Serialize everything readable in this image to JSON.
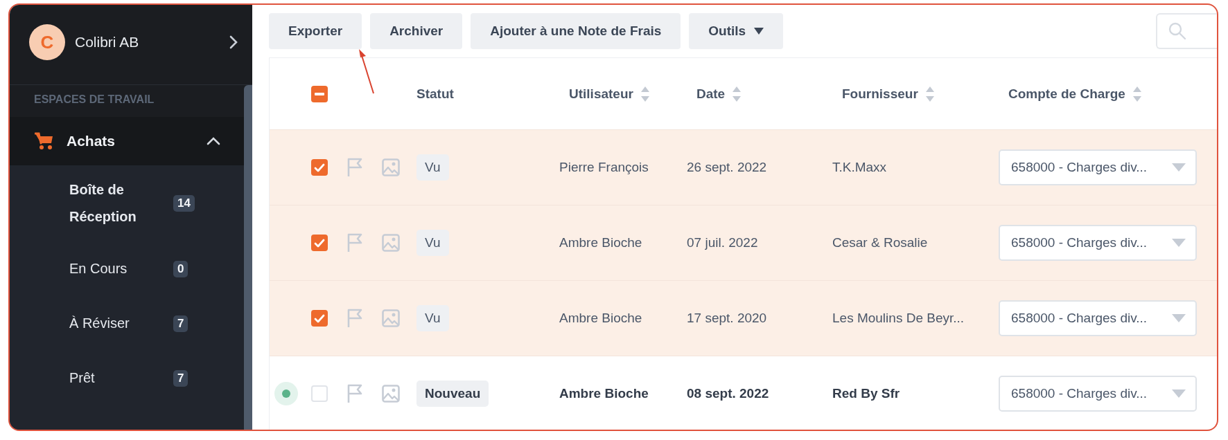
{
  "account": {
    "initial": "C",
    "name": "Colibri AB"
  },
  "sidebar": {
    "section_label": "ESPACES DE TRAVAIL",
    "group": {
      "label": "Achats",
      "expanded": true,
      "items": [
        {
          "label": "Boîte de Réception",
          "count": "14",
          "selected": true
        },
        {
          "label": "En Cours",
          "count": "0",
          "selected": false
        },
        {
          "label": "À Réviser",
          "count": "7",
          "selected": false
        },
        {
          "label": "Prêt",
          "count": "7",
          "selected": false
        }
      ]
    }
  },
  "toolbar": {
    "buttons": [
      {
        "label": "Exporter",
        "kind": "button"
      },
      {
        "label": "Archiver",
        "kind": "button"
      },
      {
        "label": "Ajouter à une Note de Frais",
        "kind": "button"
      },
      {
        "label": "Outils",
        "kind": "menu"
      }
    ]
  },
  "table": {
    "select_all": {
      "indeterminate": true
    },
    "columns": [
      {
        "label": "Statut",
        "sortable": false
      },
      {
        "label": "Utilisateur",
        "sortable": true
      },
      {
        "label": "Date",
        "sortable": true
      },
      {
        "label": "Fournisseur",
        "sortable": true
      },
      {
        "label": "Compte de Charge",
        "sortable": true
      }
    ],
    "rows": [
      {
        "selected": true,
        "unread": false,
        "status": "Vu",
        "user": "Pierre François",
        "date": "26 sept. 2022",
        "supplier": "T.K.Maxx",
        "account": "658000 - Charges div..."
      },
      {
        "selected": true,
        "unread": false,
        "status": "Vu",
        "user": "Ambre Bioche",
        "date": "07 juil. 2022",
        "supplier": "Cesar & Rosalie",
        "account": "658000 - Charges div..."
      },
      {
        "selected": true,
        "unread": false,
        "status": "Vu",
        "user": "Ambre Bioche",
        "date": "17 sept. 2020",
        "supplier": "Les Moulins De Beyr...",
        "account": "658000 - Charges div..."
      },
      {
        "selected": false,
        "unread": true,
        "status": "Nouveau",
        "user": "Ambre Bioche",
        "date": "08 sept. 2022",
        "supplier": "Red By Sfr",
        "account": "658000 - Charges div..."
      }
    ]
  }
}
